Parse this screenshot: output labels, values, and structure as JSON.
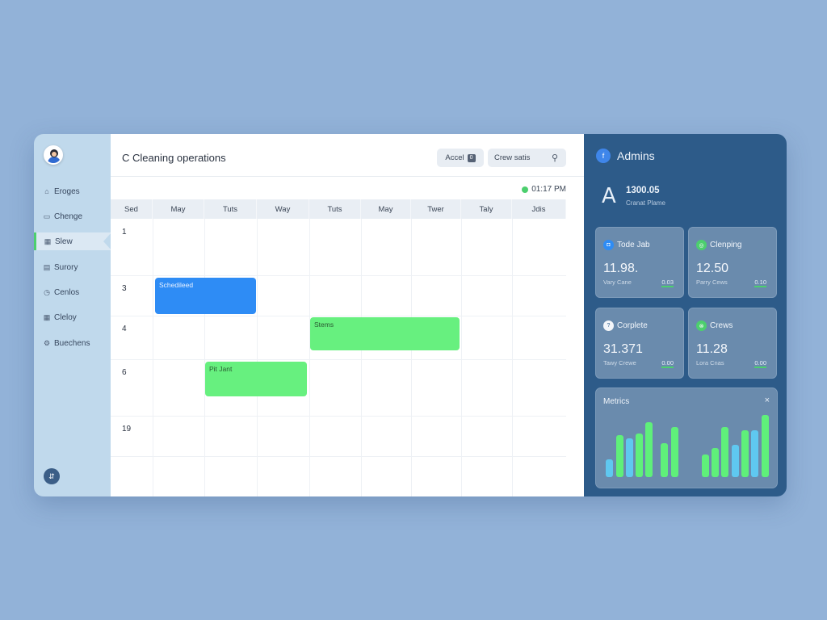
{
  "sidebar": {
    "items": [
      {
        "label": "Eroges",
        "icon": "lock-icon"
      },
      {
        "label": "Chenge",
        "icon": "folder-icon"
      },
      {
        "label": "Slew",
        "icon": "calendar-icon"
      },
      {
        "label": "Surory",
        "icon": "document-icon"
      },
      {
        "label": "Cenlos",
        "icon": "clock-icon"
      },
      {
        "label": "Cleloy",
        "icon": "grid-icon"
      },
      {
        "label": "Buechens",
        "icon": "settings-icon"
      }
    ],
    "active_index": 2
  },
  "header": {
    "title": "C Cleaning operations",
    "accel_label": "Accel",
    "accel_badge": "0",
    "search_label": "Crew satis",
    "timestamp": "01:17 PM"
  },
  "calendar": {
    "columns": [
      "Sed",
      "May",
      "Tuts",
      "Way",
      "Tuts",
      "May",
      "Twer",
      "Taly",
      "Jdis"
    ],
    "rows": [
      "1",
      "3",
      "4",
      "6",
      "19"
    ],
    "events": [
      {
        "label": "Schedileed",
        "color": "blue",
        "row": 1,
        "col_start": 1,
        "col_span": 2
      },
      {
        "label": "Stems",
        "color": "green",
        "row": 2,
        "col_start": 4,
        "col_span": 3
      },
      {
        "label": "Pit Jant",
        "color": "green",
        "row": 3,
        "col_start": 2,
        "col_span": 2
      }
    ]
  },
  "panel": {
    "title": "Admins",
    "title_icon": "f",
    "big_letter": "A",
    "big_value": "1300.05",
    "big_sub": "Cranat Plame",
    "cards": [
      {
        "title": "Tode Jab",
        "value": "11.98.",
        "sub": "Vary Cane",
        "num": "0.03",
        "icon_color": "#2e8cf5",
        "icon": "job-icon"
      },
      {
        "title": "Clenping",
        "value": "12.50",
        "sub": "Parry Cews",
        "num": "0.10",
        "icon_color": "#4ccf6e",
        "icon": "cleaning-icon"
      },
      {
        "title": "Corplete",
        "value": "31.371",
        "sub": "Tawy Crewe",
        "num": "0.00",
        "icon_color": "#f4f6f9",
        "icon": "complete-icon"
      },
      {
        "title": "Crews",
        "value": "11.28",
        "sub": "Lora Cnas",
        "num": "0.00",
        "icon_color": "#4ccf6e",
        "icon": "crews-icon"
      }
    ],
    "metrics_title": "Metrics",
    "metrics_close": "×"
  },
  "chart_data": {
    "type": "bar",
    "title": "Metrics",
    "series": [
      {
        "values": [
          22,
          52,
          48,
          54,
          68,
          42,
          62,
          28,
          36,
          62,
          40,
          58,
          58,
          77
        ]
      },
      {
        "values": [
          0,
          0,
          0,
          0,
          0,
          0,
          0,
          0,
          0,
          0,
          0,
          0,
          0,
          0
        ]
      }
    ],
    "bar_colors": [
      "#5fc8f0",
      "#5ff07a",
      "#5fc8f0",
      "#5ff07a",
      "#5ff07a",
      "#5ff07a",
      "#5ff07a",
      "#5ff07a",
      "#5ff07a",
      "#5ff07a",
      "#5fc8f0",
      "#5ff07a",
      "#5fc8f0",
      "#5ff07a"
    ],
    "ylim": [
      0,
      80
    ]
  }
}
